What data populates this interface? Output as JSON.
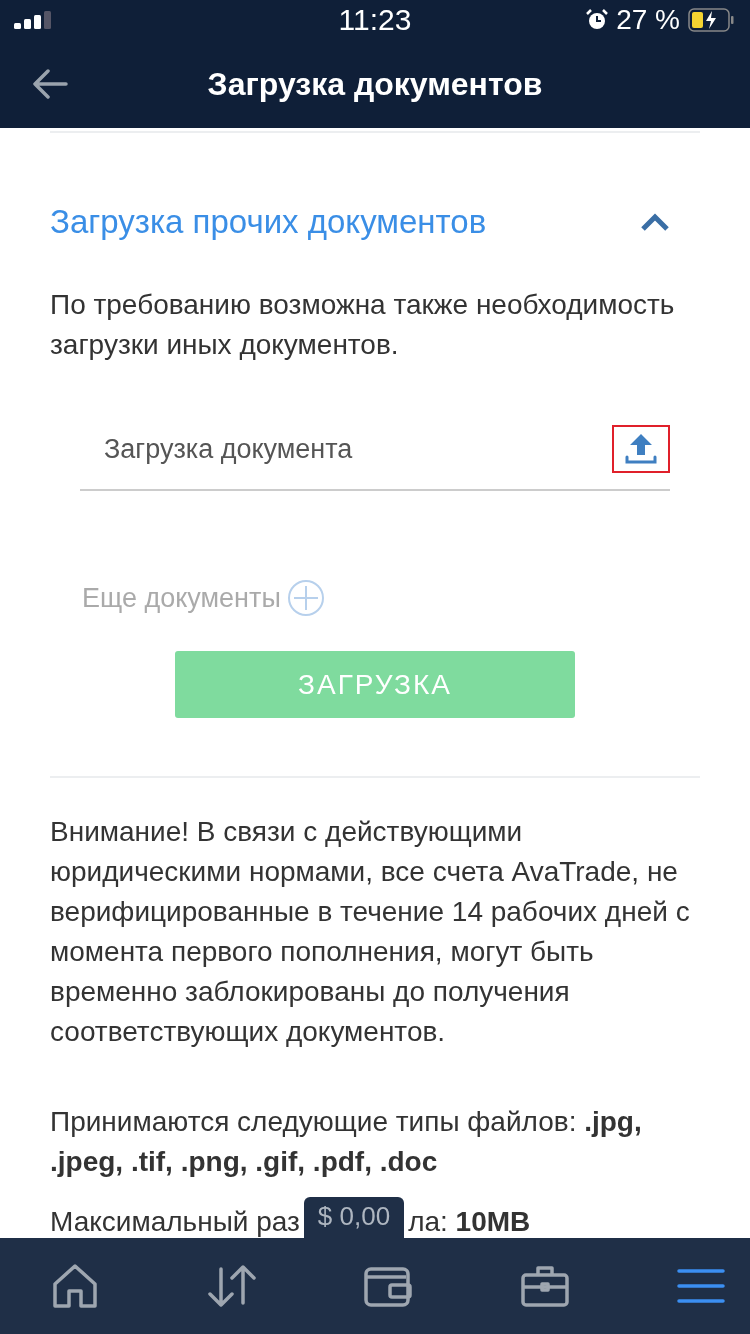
{
  "status_bar": {
    "time": "11:23",
    "battery": "27 %"
  },
  "header": {
    "title": "Загрузка документов"
  },
  "section": {
    "title": "Загрузка прочих документов",
    "expanded": true,
    "description": "По требованию возможна также необходимость загрузки иных документов.",
    "upload_field": {
      "placeholder": "Загрузка документа",
      "highlighted": true
    },
    "more_documents": "Еще документы",
    "submit_button": "ЗАГРУЗКА"
  },
  "notice": "Внимание! В связи с действующими юридическими нормами, все счета AvaTrade, не верифицированные в течение 14 рабочих дней с момента первого пополнения, могут быть временно заблокированы до получения соответствующих документов.",
  "file_types": "Принимаются следующие типы файлов: **.jpg, .jpeg, .tif, .png, .gif, .pdf, .doc**",
  "max_size": {
    "before": "Максимальный раз",
    "after": "ла: **10MB**"
  },
  "balance": "$ 0,00",
  "nav": [
    {
      "kind": "home",
      "selected": false
    },
    {
      "kind": "transfer",
      "selected": false
    },
    {
      "kind": "wallet",
      "selected": false
    },
    {
      "kind": "portfolio",
      "selected": false
    },
    {
      "kind": "menu",
      "selected": true
    }
  ]
}
